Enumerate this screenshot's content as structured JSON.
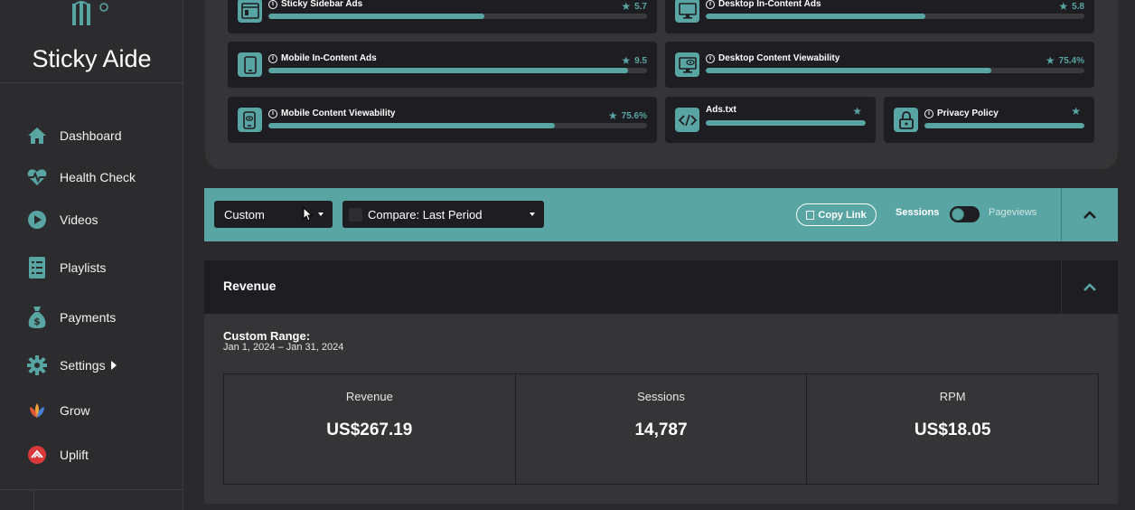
{
  "brand": {
    "name": "Sticky Aide"
  },
  "sidebar": {
    "items": [
      {
        "label": "Dashboard",
        "icon": "home-icon"
      },
      {
        "label": "Health Check",
        "icon": "heartbeat-icon"
      },
      {
        "label": "Videos",
        "icon": "play-icon"
      },
      {
        "label": "Playlists",
        "icon": "playlist-icon"
      },
      {
        "label": "Payments",
        "icon": "money-bag-icon"
      },
      {
        "label": "Settings",
        "icon": "gear-icon"
      },
      {
        "label": "Grow",
        "icon": "grow-logo-icon"
      },
      {
        "label": "Uplift",
        "icon": "uplift-logo-icon"
      }
    ]
  },
  "score_cards": [
    {
      "name": "Sticky Sidebar Ads",
      "score": "5.7",
      "fill": 0.57,
      "icon": "sidebar-layout-icon"
    },
    {
      "name": "Desktop In-Content Ads",
      "score": "5.8",
      "fill": 0.58,
      "icon": "desktop-icon"
    },
    {
      "name": "Mobile In-Content Ads",
      "score": "9.5",
      "fill": 0.95,
      "icon": "mobile-icon"
    },
    {
      "name": "Desktop Content Viewability",
      "score": "75.4%",
      "fill": 0.754,
      "icon": "desktop-eye-icon"
    },
    {
      "name": "Mobile Content Viewability",
      "score": "75.6%",
      "fill": 0.756,
      "icon": "mobile-eye-icon"
    },
    {
      "name": "Ads.txt",
      "score": "",
      "fill": 1.0,
      "icon": "code-icon"
    },
    {
      "name": "Privacy Policy",
      "score": "",
      "fill": 1.0,
      "icon": "lock-icon"
    }
  ],
  "toolbar": {
    "range_select": "Custom",
    "compare_select": "Compare: Last Period",
    "copy_link": "Copy Link",
    "toggle_left": "Sessions",
    "toggle_right": "Pageviews"
  },
  "revenue": {
    "title": "Revenue",
    "range_title": "Custom Range:",
    "range_dates": "Jan 1, 2024 – Jan 31, 2024",
    "metrics": [
      {
        "label": "Revenue",
        "value": "US$267.19"
      },
      {
        "label": "Sessions",
        "value": "14,787"
      },
      {
        "label": "RPM",
        "value": "US$18.05"
      }
    ]
  },
  "colors": {
    "accent": "#58a5a3",
    "card_bg": "#1e1d21",
    "panel_bg": "#353537"
  }
}
